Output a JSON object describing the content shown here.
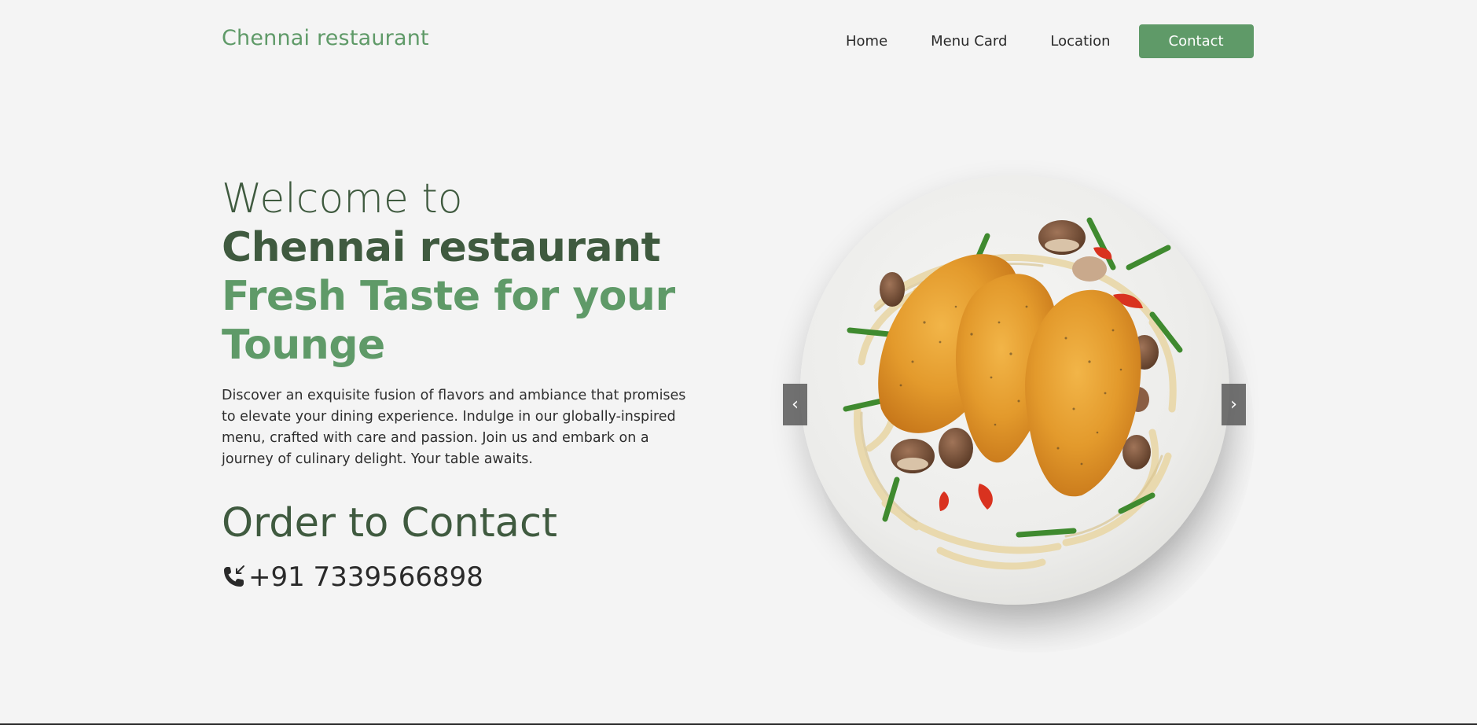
{
  "header": {
    "brand": "Chennai restaurant",
    "nav": {
      "home": "Home",
      "menu_card": "Menu Card",
      "location": "Location",
      "contact": "Contact"
    }
  },
  "hero": {
    "welcome": "Welcome to",
    "name": "Chennai restaurant",
    "tagline": "Fresh Taste for your Tounge",
    "description": "Discover an exquisite fusion of flavors and ambiance that promises to elevate your dining experience. Indulge in our globally-inspired menu, crafted with care and passion. Join us and embark on a journey of culinary delight. Your table awaits.",
    "order_title": "Order to Contact",
    "phone": "+91 7339566898"
  },
  "carousel": {
    "prev_label": "‹",
    "next_label": "›",
    "image_subject": "grilled chicken breasts on fettuccine with mushrooms, green beans and red peppers"
  },
  "icons": {
    "phone": "phone-call-icon"
  },
  "colors": {
    "accent": "#5f9a68",
    "heading_dark": "#3f5a3f",
    "background": "#f4f4f4"
  }
}
